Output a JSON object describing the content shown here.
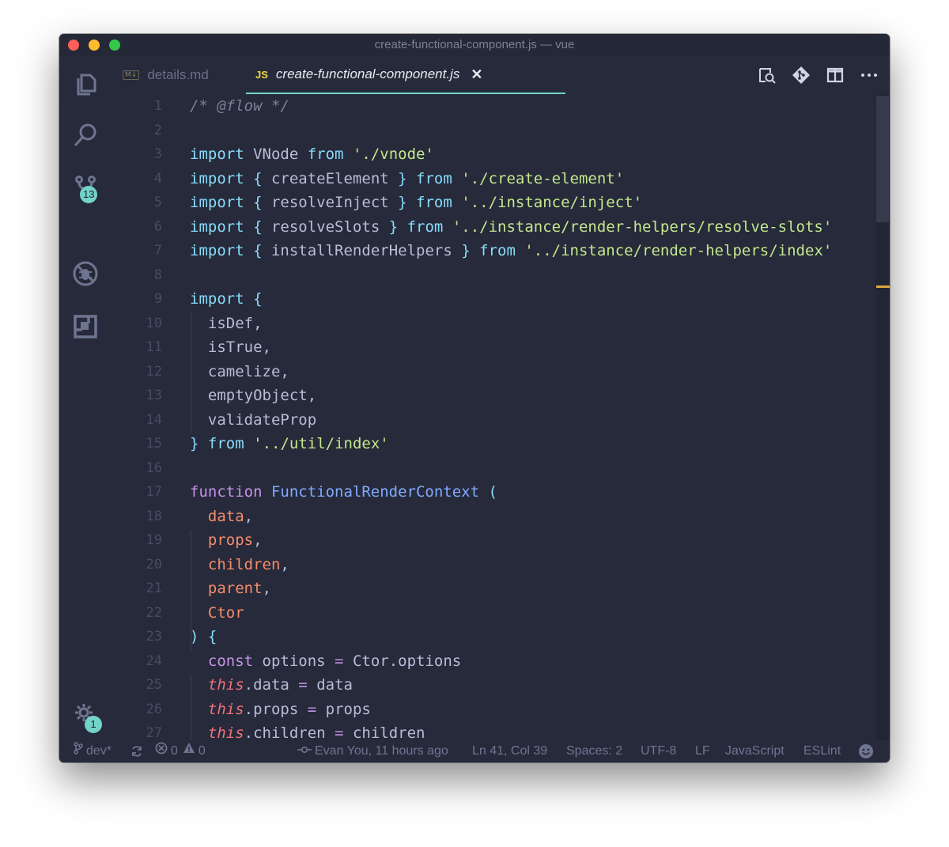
{
  "window": {
    "title": "create-functional-component.js — vue"
  },
  "activity_bar": {
    "items": [
      {
        "icon": "files-icon"
      },
      {
        "icon": "search-icon"
      },
      {
        "icon": "source-control-icon",
        "badge": "13"
      },
      {
        "icon": "debug-icon"
      },
      {
        "icon": "extensions-icon"
      }
    ],
    "settings": {
      "icon": "gear-icon",
      "badge": "1"
    }
  },
  "tabs": [
    {
      "icon": "M↓",
      "label": "details.md",
      "active": false
    },
    {
      "icon": "JS",
      "label": "create-functional-component.js",
      "active": true,
      "close": "✕"
    }
  ],
  "tab_actions": [
    "open-preview-icon",
    "git-compare-icon",
    "split-editor-icon",
    "more-icon"
  ],
  "editor": {
    "lines": [
      {
        "n": "1",
        "tokens": [
          [
            "/* @flow */",
            "comment"
          ]
        ]
      },
      {
        "n": "2",
        "tokens": []
      },
      {
        "n": "3",
        "tokens": [
          [
            "import",
            "keyword"
          ],
          [
            " VNode ",
            "plain"
          ],
          [
            "from",
            "keyword"
          ],
          [
            " ",
            "plain"
          ],
          [
            "'./vnode'",
            "string"
          ]
        ]
      },
      {
        "n": "4",
        "tokens": [
          [
            "import",
            "keyword"
          ],
          [
            " ",
            "plain"
          ],
          [
            "{",
            "punct"
          ],
          [
            " createElement ",
            "plain"
          ],
          [
            "}",
            "punct"
          ],
          [
            " ",
            "plain"
          ],
          [
            "from",
            "keyword"
          ],
          [
            " ",
            "plain"
          ],
          [
            "'./create-element'",
            "string"
          ]
        ]
      },
      {
        "n": "5",
        "tokens": [
          [
            "import",
            "keyword"
          ],
          [
            " ",
            "plain"
          ],
          [
            "{",
            "punct"
          ],
          [
            " resolveInject ",
            "plain"
          ],
          [
            "}",
            "punct"
          ],
          [
            " ",
            "plain"
          ],
          [
            "from",
            "keyword"
          ],
          [
            " ",
            "plain"
          ],
          [
            "'../instance/inject'",
            "string"
          ]
        ]
      },
      {
        "n": "6",
        "tokens": [
          [
            "import",
            "keyword"
          ],
          [
            " ",
            "plain"
          ],
          [
            "{",
            "punct"
          ],
          [
            " resolveSlots ",
            "plain"
          ],
          [
            "}",
            "punct"
          ],
          [
            " ",
            "plain"
          ],
          [
            "from",
            "keyword"
          ],
          [
            " ",
            "plain"
          ],
          [
            "'../instance/render-helpers/resolve-slots'",
            "string"
          ]
        ]
      },
      {
        "n": "7",
        "tokens": [
          [
            "import",
            "keyword"
          ],
          [
            " ",
            "plain"
          ],
          [
            "{",
            "punct"
          ],
          [
            " installRenderHelpers ",
            "plain"
          ],
          [
            "}",
            "punct"
          ],
          [
            " ",
            "plain"
          ],
          [
            "from",
            "keyword"
          ],
          [
            " ",
            "plain"
          ],
          [
            "'../instance/render-helpers/index'",
            "string"
          ]
        ]
      },
      {
        "n": "8",
        "tokens": []
      },
      {
        "n": "9",
        "tokens": [
          [
            "import",
            "keyword"
          ],
          [
            " ",
            "plain"
          ],
          [
            "{",
            "punct"
          ]
        ]
      },
      {
        "n": "10",
        "tokens": [
          [
            "  isDef,",
            "plain"
          ]
        ]
      },
      {
        "n": "11",
        "tokens": [
          [
            "  isTrue,",
            "plain"
          ]
        ]
      },
      {
        "n": "12",
        "tokens": [
          [
            "  camelize,",
            "plain"
          ]
        ]
      },
      {
        "n": "13",
        "tokens": [
          [
            "  emptyObject,",
            "plain"
          ]
        ]
      },
      {
        "n": "14",
        "tokens": [
          [
            "  validateProp",
            "plain"
          ]
        ]
      },
      {
        "n": "15",
        "tokens": [
          [
            "}",
            "punct"
          ],
          [
            " ",
            "plain"
          ],
          [
            "from",
            "keyword"
          ],
          [
            " ",
            "plain"
          ],
          [
            "'../util/index'",
            "string"
          ]
        ]
      },
      {
        "n": "16",
        "tokens": []
      },
      {
        "n": "17",
        "tokens": [
          [
            "function",
            "func-kw"
          ],
          [
            " ",
            "plain"
          ],
          [
            "FunctionalRenderContext",
            "func-name"
          ],
          [
            " ",
            "plain"
          ],
          [
            "(",
            "punct"
          ]
        ]
      },
      {
        "n": "18",
        "tokens": [
          [
            "  ",
            "plain"
          ],
          [
            "data",
            "param"
          ],
          [
            ",",
            "plain"
          ]
        ]
      },
      {
        "n": "19",
        "tokens": [
          [
            "  ",
            "plain"
          ],
          [
            "props",
            "param"
          ],
          [
            ",",
            "plain"
          ]
        ]
      },
      {
        "n": "20",
        "tokens": [
          [
            "  ",
            "plain"
          ],
          [
            "children",
            "param"
          ],
          [
            ",",
            "plain"
          ]
        ]
      },
      {
        "n": "21",
        "tokens": [
          [
            "  ",
            "plain"
          ],
          [
            "parent",
            "param"
          ],
          [
            ",",
            "plain"
          ]
        ]
      },
      {
        "n": "22",
        "tokens": [
          [
            "  ",
            "plain"
          ],
          [
            "Ctor",
            "param"
          ]
        ]
      },
      {
        "n": "23",
        "tokens": [
          [
            ")",
            "punct"
          ],
          [
            " ",
            "plain"
          ],
          [
            "{",
            "punct"
          ]
        ]
      },
      {
        "n": "24",
        "tokens": [
          [
            "  ",
            "plain"
          ],
          [
            "const",
            "func-kw"
          ],
          [
            " options ",
            "plain"
          ],
          [
            "=",
            "op"
          ],
          [
            " Ctor.options",
            "plain"
          ]
        ]
      },
      {
        "n": "25",
        "tokens": [
          [
            "  ",
            "plain"
          ],
          [
            "this",
            "this"
          ],
          [
            ".data ",
            "plain"
          ],
          [
            "=",
            "op"
          ],
          [
            " data",
            "plain"
          ]
        ]
      },
      {
        "n": "26",
        "tokens": [
          [
            "  ",
            "plain"
          ],
          [
            "this",
            "this"
          ],
          [
            ".props ",
            "plain"
          ],
          [
            "=",
            "op"
          ],
          [
            " props",
            "plain"
          ]
        ]
      },
      {
        "n": "27",
        "tokens": [
          [
            "  ",
            "plain"
          ],
          [
            "this",
            "this"
          ],
          [
            ".children ",
            "plain"
          ],
          [
            "=",
            "op"
          ],
          [
            " children",
            "plain"
          ]
        ]
      }
    ]
  },
  "status_bar": {
    "branch": "dev*",
    "errors": "0",
    "warnings": "0",
    "blame": "Evan You, 11 hours ago",
    "position": "Ln 41, Col 39",
    "indent": "Spaces: 2",
    "encoding": "UTF-8",
    "eol": "LF",
    "language": "JavaScript",
    "linter": "ESLint"
  },
  "colors": {
    "background": "#262a3a",
    "keyword": "#89dcfc",
    "string": "#c3e88d",
    "function_name": "#82aaff",
    "param": "#f78c6c",
    "this": "#f07178",
    "accent": "#74d3c9"
  }
}
